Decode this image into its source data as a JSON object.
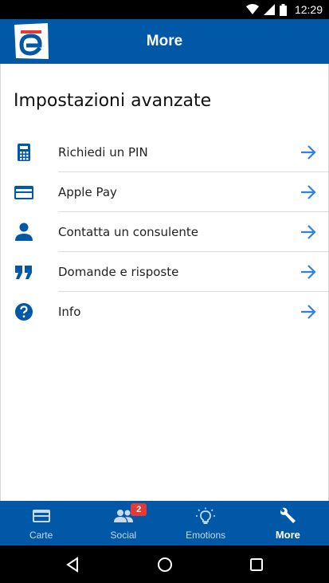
{
  "status_bar": {
    "time": "12:29"
  },
  "app_bar": {
    "title": "More",
    "logo_letter": "e"
  },
  "section": {
    "title": "Impostazioni avanzate"
  },
  "menu": [
    {
      "label": "Richiedi un PIN",
      "icon": "calculator-icon"
    },
    {
      "label": "Apple Pay",
      "icon": "credit-card-icon"
    },
    {
      "label": "Contatta un consulente",
      "icon": "person-icon"
    },
    {
      "label": "Domande e risposte",
      "icon": "quote-icon"
    },
    {
      "label": "Info",
      "icon": "help-circle-icon"
    }
  ],
  "bottom_nav": [
    {
      "label": "Carte",
      "icon": "card-icon",
      "active": false
    },
    {
      "label": "Social",
      "icon": "people-icon",
      "badge": "2",
      "active": false
    },
    {
      "label": "Emotions",
      "icon": "lightbulb-icon",
      "active": false
    },
    {
      "label": "More",
      "icon": "wrench-icon",
      "active": true
    }
  ],
  "colors": {
    "primary": "#0158a6",
    "accent_arrow": "#2f80ed",
    "badge": "#e53935"
  }
}
